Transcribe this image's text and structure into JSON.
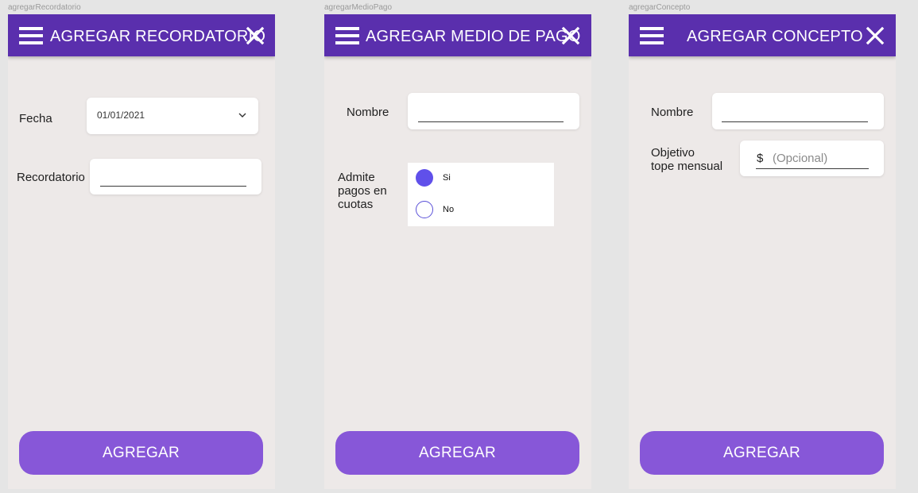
{
  "frames": [
    {
      "name": "agregarRecordatorio",
      "title": "AGREGAR RECORDATORIO",
      "fields": {
        "fecha_label": "Fecha",
        "fecha_value": "01/01/2021",
        "recordatorio_label": "Recordatorio",
        "recordatorio_value": ""
      },
      "button_label": "AGREGAR"
    },
    {
      "name": "agregarMedioPago",
      "title": "AGREGAR MEDIO DE PAGO",
      "fields": {
        "nombre_label": "Nombre",
        "nombre_value": "",
        "cuotas_label_line1": "Admite",
        "cuotas_label_line2": "pagos en",
        "cuotas_label_line3": "cuotas",
        "options": [
          {
            "label": "Si",
            "selected": true
          },
          {
            "label": "No",
            "selected": false
          }
        ]
      },
      "button_label": "AGREGAR"
    },
    {
      "name": "agregarConcepto",
      "title": "AGREGAR CONCEPTO",
      "fields": {
        "nombre_label": "Nombre",
        "nombre_value": "",
        "objetivo_label_line1": "Objetivo",
        "objetivo_label_line2": "tope mensual",
        "currency_symbol": "$",
        "objetivo_placeholder": "(Opcional)"
      },
      "button_label": "AGREGAR"
    }
  ],
  "icons": {
    "menu": "hamburger-icon",
    "close": "close-icon",
    "dropdown": "chevron-down-icon"
  },
  "colors": {
    "appbar": "#5a2fad",
    "button": "#8757d8",
    "radio_selected": "#6050ea",
    "background": "#ede9e8"
  }
}
